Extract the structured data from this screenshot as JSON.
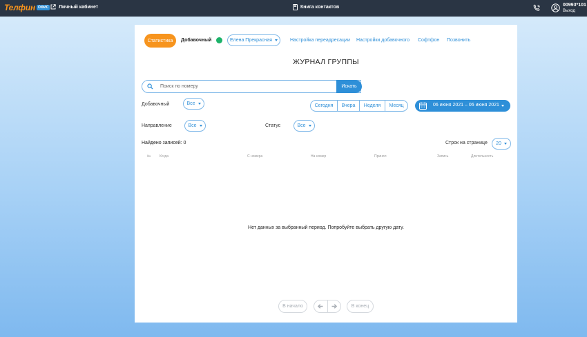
{
  "topbar": {
    "logo_text": "Телфин",
    "logo_badge": "ОФИС",
    "cabinet_label": "Личный кабинет",
    "contacts_label": "Книга контактов",
    "user_id": "00993*101",
    "logout_label": "Выход"
  },
  "nav": {
    "stats_label": "Статистика",
    "extension_label": "Добавочный",
    "extension_select": "Елена Прекрасная",
    "links": [
      "Настройка переадресации",
      "Настройки добавочного",
      "Софтфон",
      "Позвонить"
    ]
  },
  "page_title": "ЖУРНАЛ ГРУППЫ",
  "search": {
    "placeholder": "Поиск по номеру",
    "button": "Искать"
  },
  "filters": {
    "extension_label": "Добавочный",
    "extension_value": "Все",
    "direction_label": "Направление",
    "direction_value": "Все",
    "status_label": "Статус",
    "status_value": "Все"
  },
  "periods": [
    "Сегодня",
    "Вчера",
    "Неделя",
    "Месяц"
  ],
  "date_range": "06 июня 2021 – 06 июня 2021",
  "found_label": "Найдено записей: 0",
  "rows_per_page_label": "Строк на странице",
  "rows_per_page_value": "20",
  "table_headers": [
    "№",
    "Когда",
    "С номера",
    "На номер",
    "Принял",
    "Запись",
    "Длительность"
  ],
  "empty_message": "Нет данных за выбранный период. Попробуйте выбрать другую дату.",
  "pagination": {
    "first": "В начало",
    "last": "В конец"
  },
  "colors": {
    "topbar": "#2a3544",
    "accent_orange": "#f7941d",
    "accent_blue": "#2e8fd8",
    "status_green": "#1db36a"
  }
}
